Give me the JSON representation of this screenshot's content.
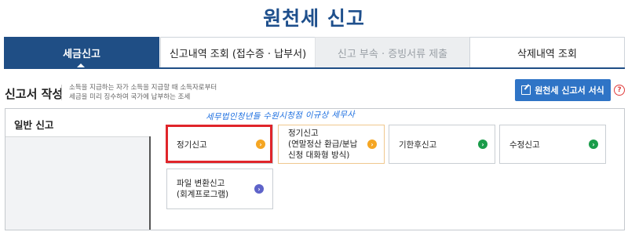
{
  "page": {
    "title": "원천세 신고"
  },
  "tabs": [
    {
      "label": "세금신고",
      "active": true
    },
    {
      "label": "신고내역 조회 (접수증 · 납부서)"
    },
    {
      "label": "신고 부속 · 증빙서류 제출",
      "disabled": true
    },
    {
      "label": "삭제내역 조회"
    }
  ],
  "section": {
    "title": "신고서 작성",
    "desc_line1": "소득을 지급하는 자가 소득을 지급할 때 소득자로부터",
    "desc_line2": "세금을 미리 징수하여 국가에 납부하는 조세",
    "form_button": "원천세 신고서 서식",
    "help": "?"
  },
  "left_menu": {
    "label": "일반 신고"
  },
  "annotation": "세무법인청년들 수원시청점 이규상 세무사",
  "cards": [
    {
      "line1": "정기신고",
      "line2": "",
      "line3": "",
      "arrow": "›",
      "dot_color": "#f5a623",
      "icon": "chevron-right-icon"
    },
    {
      "line1": "정기신고",
      "line2": "(연말정산 환급/분납",
      "line3": "신청 대화형 방식)",
      "arrow": "›",
      "dot_color": "#f5a623",
      "icon": "chevron-right-icon"
    },
    {
      "line1": "기한후신고",
      "arrow": "›",
      "dot_color": "#1a9c4a",
      "icon": "chevron-right-icon"
    },
    {
      "line1": "수정신고",
      "arrow": "›",
      "dot_color": "#1a9c4a",
      "icon": "chevron-right-icon"
    },
    {
      "line1": "파일 변환신고",
      "line2": "(회계프로그램)",
      "arrow": "›",
      "dot_color": "#5e63c9",
      "icon": "chevron-right-icon"
    }
  ]
}
